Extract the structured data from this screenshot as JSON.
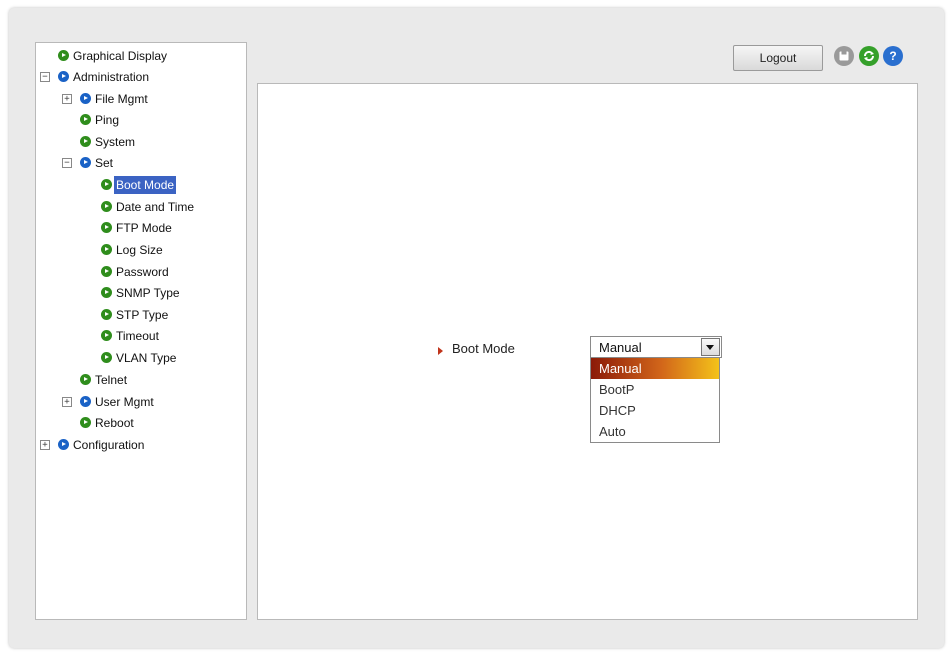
{
  "toolbar": {
    "logout_label": "Logout",
    "icons": [
      "save-icon",
      "refresh-icon",
      "help-icon"
    ]
  },
  "tree": {
    "graphical_display": "Graphical Display",
    "administration": "Administration",
    "file_mgmt": "File Mgmt",
    "ping": "Ping",
    "system": "System",
    "set": "Set",
    "boot_mode": "Boot Mode",
    "date_and_time": "Date and Time",
    "ftp_mode": "FTP Mode",
    "log_size": "Log Size",
    "password": "Password",
    "snmp_type": "SNMP Type",
    "stp_type": "STP Type",
    "timeout": "Timeout",
    "vlan_type": "VLAN Type",
    "telnet": "Telnet",
    "user_mgmt": "User Mgmt",
    "reboot": "Reboot",
    "configuration": "Configuration",
    "selected": "Boot Mode"
  },
  "form": {
    "field_label": "Boot Mode",
    "selected_value": "Manual",
    "options": [
      "Manual",
      "BootP",
      "DHCP",
      "Auto"
    ],
    "highlighted_option": "Manual"
  },
  "colors": {
    "leaf_bullet": "#2f8d1c",
    "folder_bullet": "#1a62c6",
    "selection": "#3b63c3",
    "highlight_gradient": [
      "#8b1a08",
      "#f4c21a"
    ]
  }
}
